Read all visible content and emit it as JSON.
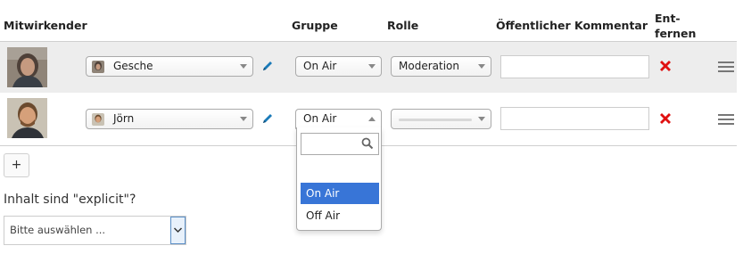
{
  "headers": {
    "mitwirkender": "Mitwirkender",
    "gruppe": "Gruppe",
    "rolle": "Rolle",
    "kommentar": "Öffentlicher Kommentar",
    "entfernen_1": "Ent-",
    "entfernen_2": "fernen"
  },
  "rows": [
    {
      "name": "Gesche",
      "gruppe": "On Air",
      "rolle": "Moderation",
      "kommentar": ""
    },
    {
      "name": "Jörn",
      "gruppe": "On Air",
      "rolle": "",
      "kommentar": ""
    }
  ],
  "add_button": "+",
  "explicit": {
    "label": "Inhalt sind \"explicit\"?",
    "selected": "Bitte auswählen ..."
  },
  "dropdown": {
    "search_value": "",
    "options": [
      "On Air",
      "Off Air"
    ],
    "highlighted": "On Air"
  },
  "colors": {
    "accent": "#3875d7",
    "remove": "#e01010",
    "edit": "#1a7ab8",
    "row_alt": "#ededed"
  }
}
